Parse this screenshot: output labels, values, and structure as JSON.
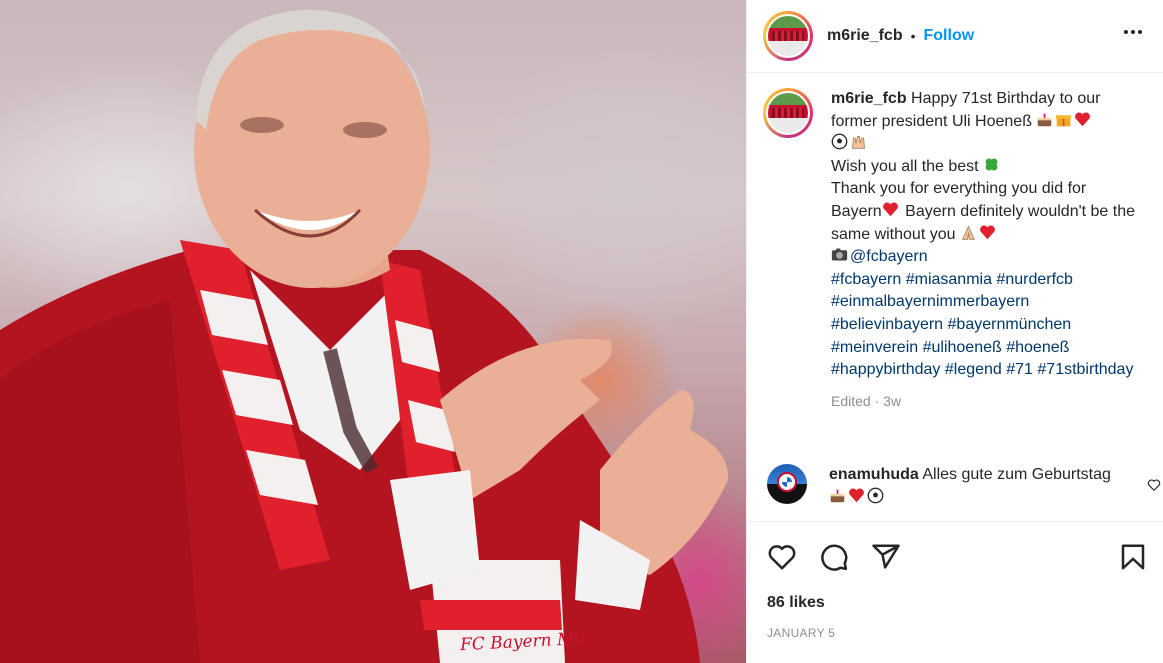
{
  "post": {
    "username": "m6rie_fcb",
    "follow_label": "Follow",
    "separator": "•",
    "photo_scarf_text": "FC Bayern Mü"
  },
  "caption": {
    "username": "m6rie_fcb",
    "line1": " Happy 71st Birthday to our former president Uli Hoeneß",
    "line2": "Wish you all the best",
    "line3a": "Thank you for everything you did for Bayern",
    "line3b": " Bayern definitely wouldn't be the same without you",
    "credit": "@fcbayern",
    "hashtags": "#fcbayern #miasanmia #nurderfcb #einmalbayernimmerbayern #believinbayern #bayernmünchen #meinverein #ulihoeneß #hoeneß #happybirthday #legend #71 #71stbirthday",
    "edited": "Edited",
    "meta_separator": " · ",
    "age": "3w"
  },
  "comment": {
    "username": "enamuhuda",
    "text": " Alles gute zum Geburtstag"
  },
  "actions": {
    "likes": "86 likes",
    "date": "JANUARY 5"
  },
  "icons": {
    "more": "more-options-icon",
    "like": "heart-icon",
    "comment": "comment-icon",
    "share": "share-icon",
    "save": "bookmark-icon"
  },
  "colors": {
    "link": "#0095f6",
    "hashtag": "#00376b",
    "muted": "#8e8e8e",
    "bayern_red": "#c8102e"
  }
}
